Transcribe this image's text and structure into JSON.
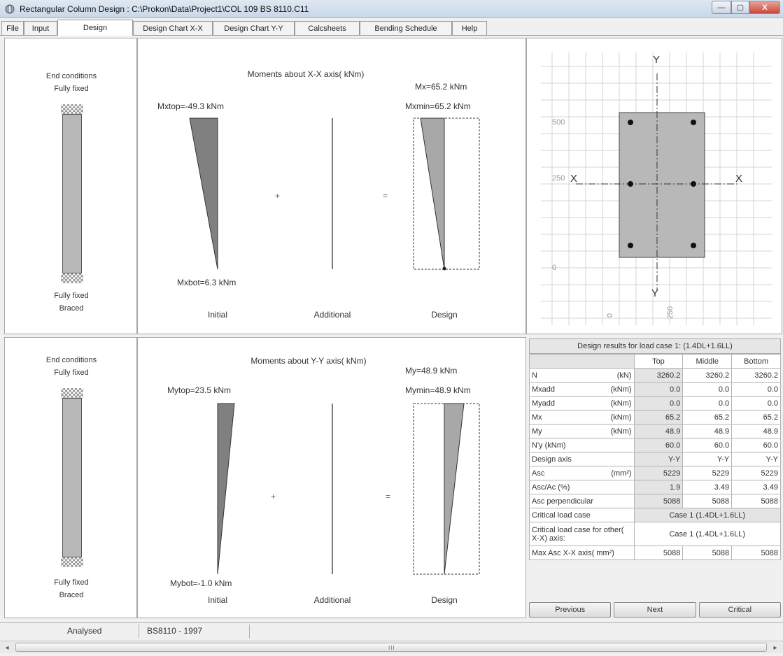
{
  "window": {
    "title": "Rectangular Column Design : C:\\Prokon\\Data\\Project1\\COL 109 BS 8110.C11",
    "minimize": "—",
    "maximize": "▢",
    "close": "X"
  },
  "tabs": [
    "File",
    "Input",
    "Design",
    "Design Chart X-X",
    "Design Chart Y-Y",
    "Calcsheets",
    "Bending Schedule",
    "Help"
  ],
  "active_tab": "Design",
  "xx_panel": {
    "end_conditions_label": "End conditions",
    "top_condition": "Fully fixed",
    "bottom_condition": "Fully fixed",
    "braced": "Braced",
    "title": "Moments about X-X axis( kNm)",
    "m_design": "Mx=65.2 kNm",
    "m_top": "Mxtop=-49.3 kNm",
    "m_min": "Mxmin=65.2 kNm",
    "m_bot": "Mxbot=6.3 kNm",
    "plus": "+",
    "equals": "=",
    "initial": "Initial",
    "additional": "Additional",
    "design": "Design"
  },
  "yy_panel": {
    "end_conditions_label": "End conditions",
    "top_condition": "Fully fixed",
    "bottom_condition": "Fully fixed",
    "braced": "Braced",
    "title": "Moments about Y-Y axis( kNm)",
    "m_design": "My=48.9 kNm",
    "m_top": "Mytop=23.5 kNm",
    "m_min": "Mymin=48.9 kNm",
    "m_bot": "Mybot=-1.0 kNm",
    "plus": "+",
    "equals": "=",
    "initial": "Initial",
    "additional": "Additional",
    "design": "Design"
  },
  "section": {
    "label_y_top": "Y",
    "label_y_bottom": "Y",
    "label_x_left": "X",
    "label_x_right": "X",
    "tick_500": "500",
    "tick_250": "250",
    "tick_0_left": "0",
    "tick_0_bottom": "0",
    "tick_250_bottom": "250"
  },
  "results": {
    "header": "Design results for load case    1: (1.4DL+1.6LL)",
    "columns": [
      "",
      "Top",
      "Middle",
      "Bottom"
    ],
    "rows": [
      {
        "label": "N",
        "unit": "(kN)",
        "top": "3260.2",
        "middle": "3260.2",
        "bottom": "3260.2"
      },
      {
        "label": "Mxadd",
        "unit": "(kNm)",
        "top": "0.0",
        "middle": "0.0",
        "bottom": "0.0"
      },
      {
        "label": "Myadd",
        "unit": "(kNm)",
        "top": "0.0",
        "middle": "0.0",
        "bottom": "0.0"
      },
      {
        "label": "Mx",
        "unit": "(kNm)",
        "top": "65.2",
        "middle": "65.2",
        "bottom": "65.2"
      },
      {
        "label": "My",
        "unit": "(kNm)",
        "top": "48.9",
        "middle": "48.9",
        "bottom": "48.9"
      },
      {
        "label": "N'y (kNm)",
        "unit": "",
        "top": "60.0",
        "middle": "60.0",
        "bottom": "60.0"
      },
      {
        "label": "Design axis",
        "unit": "",
        "top": "Y-Y",
        "middle": "Y-Y",
        "bottom": "Y-Y"
      },
      {
        "label": "Asc",
        "unit": "(mm²)",
        "top": "5229",
        "middle": "5229",
        "bottom": "5229"
      },
      {
        "label": "Asc/Ac (%)",
        "unit": "",
        "top": "1.9",
        "middle": "3.49",
        "bottom": "3.49"
      },
      {
        "label": "Asc perpendicular",
        "unit": "",
        "top": "5088",
        "middle": "5088",
        "bottom": "5088"
      }
    ],
    "critical_label": "Critical load case",
    "critical_value": "Case 1 (1.4DL+1.6LL)",
    "critical_other_label": "Critical load case for other( X-X) axis:",
    "critical_other_value": "Case 1 (1.4DL+1.6LL)",
    "max_asc_label": "Max Asc X-X axis( mm²)",
    "max_asc_values": [
      "5088",
      "5088",
      "5088"
    ]
  },
  "buttons": {
    "previous": "Previous",
    "next": "Next",
    "critical": "Critical"
  },
  "status": {
    "state": "Analysed",
    "code": "BS8110 - 1997"
  },
  "scrollbar": {
    "left_arrow": "◂",
    "right_arrow": "▸",
    "grip": "III"
  }
}
